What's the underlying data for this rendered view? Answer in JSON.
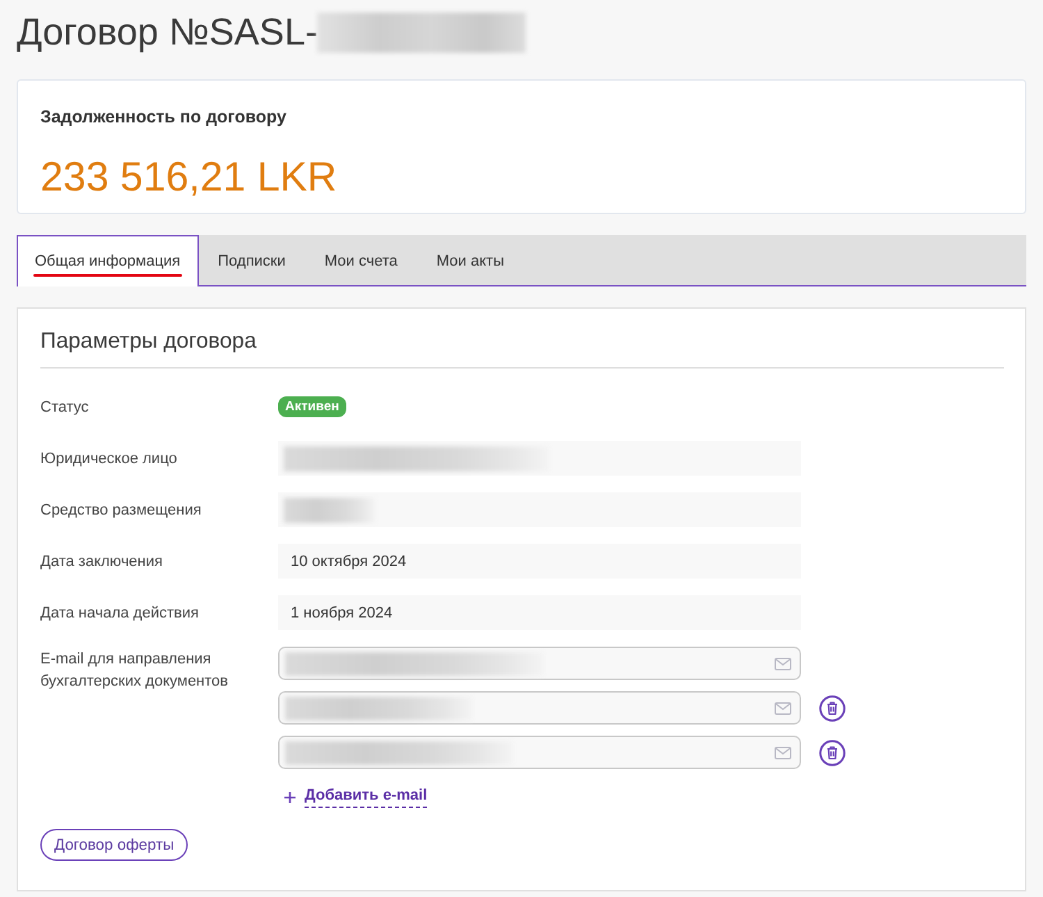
{
  "page": {
    "title": "Договор №SASL-",
    "title_blurred": true
  },
  "debt": {
    "label": "Задолженность по договору",
    "amount": "233 516,21 LKR"
  },
  "tabs": [
    {
      "label": "Общая информация",
      "selected": true,
      "marked": true
    },
    {
      "label": "Подписки",
      "selected": false,
      "marked": false
    },
    {
      "label": "Мои счета",
      "selected": false,
      "marked": false
    },
    {
      "label": "Мои акты",
      "selected": false,
      "marked": false
    }
  ],
  "panel": {
    "title": "Параметры договора",
    "fields": [
      {
        "kind": "status",
        "label": "Статус",
        "badge": "Активен"
      },
      {
        "kind": "blurred",
        "label": "Юридическое лицо"
      },
      {
        "kind": "blurred",
        "label": "Средство размещения"
      },
      {
        "kind": "text",
        "label": "Дата заключения",
        "value": "10 октября 2024"
      },
      {
        "kind": "text",
        "label": "Дата начала действия",
        "value": "1 ноября 2024"
      }
    ],
    "emails": {
      "label": "E-mail для направления бухгалтерских документов",
      "inputs": [
        {
          "blurred": true,
          "removable": false
        },
        {
          "blurred": true,
          "removable": true
        },
        {
          "blurred": true,
          "removable": true
        }
      ],
      "add_link": "Добавить e-mail"
    },
    "offer_button": "Договор оферты"
  }
}
